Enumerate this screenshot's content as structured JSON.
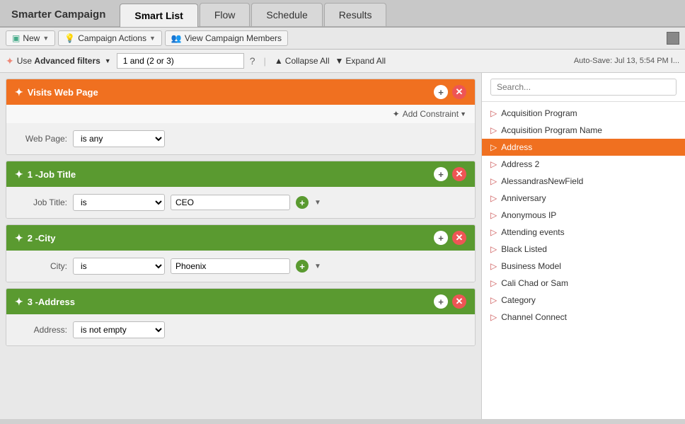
{
  "app": {
    "title": "Smarter Campaign"
  },
  "tabs": [
    {
      "id": "smart-list",
      "label": "Smart List",
      "active": true
    },
    {
      "id": "flow",
      "label": "Flow",
      "active": false
    },
    {
      "id": "schedule",
      "label": "Schedule",
      "active": false
    },
    {
      "id": "results",
      "label": "Results",
      "active": false
    }
  ],
  "toolbar": {
    "new_label": "New",
    "campaign_actions_label": "Campaign Actions",
    "view_members_label": "View Campaign Members"
  },
  "filter_bar": {
    "advanced_label": "Use Advanced filters",
    "logic": "1 and (2 or 3)",
    "help_title": "?",
    "sep": "|",
    "collapse_all": "Collapse All",
    "expand_all": "Expand All",
    "autosave": "Auto-Save: Jul 13, 5:54 PM I..."
  },
  "filter_cards": [
    {
      "id": "visits-web-page",
      "title": "Visits Web Page",
      "header_class": "orange",
      "add_constraint_label": "Add Constraint",
      "fields": [
        {
          "label": "Web Page:",
          "operator": "is any",
          "value": null
        }
      ]
    },
    {
      "id": "job-title",
      "number": "1",
      "title": "Job Title",
      "header_class": "green",
      "fields": [
        {
          "label": "Job Title:",
          "operator": "is",
          "value": "CEO"
        }
      ]
    },
    {
      "id": "city",
      "number": "2",
      "title": "City",
      "header_class": "green",
      "fields": [
        {
          "label": "City:",
          "operator": "is",
          "value": "Phoenix"
        }
      ]
    },
    {
      "id": "address",
      "number": "3",
      "title": "Address",
      "header_class": "green",
      "fields": [
        {
          "label": "Address:",
          "operator": "is not empty",
          "value": null
        }
      ]
    }
  ],
  "right_panel": {
    "search_placeholder": "Search...",
    "attributes": [
      {
        "id": "acquisition-program",
        "label": "Acquisition Program",
        "active": false
      },
      {
        "id": "acquisition-program-name",
        "label": "Acquisition Program Name",
        "active": false
      },
      {
        "id": "address",
        "label": "Address",
        "active": true
      },
      {
        "id": "address-2",
        "label": "Address 2",
        "active": false
      },
      {
        "id": "alessandras-new-field",
        "label": "AlessandrasNewField",
        "active": false
      },
      {
        "id": "anniversary",
        "label": "Anniversary",
        "active": false
      },
      {
        "id": "anonymous-ip",
        "label": "Anonymous IP",
        "active": false
      },
      {
        "id": "attending-events",
        "label": "Attending events",
        "active": false
      },
      {
        "id": "black-listed",
        "label": "Black Listed",
        "active": false
      },
      {
        "id": "business-model",
        "label": "Business Model",
        "active": false
      },
      {
        "id": "cali-chad-or-sam",
        "label": "Cali Chad or Sam",
        "active": false
      },
      {
        "id": "category",
        "label": "Category",
        "active": false
      },
      {
        "id": "channel-connect",
        "label": "Channel Connect",
        "active": false
      }
    ]
  }
}
